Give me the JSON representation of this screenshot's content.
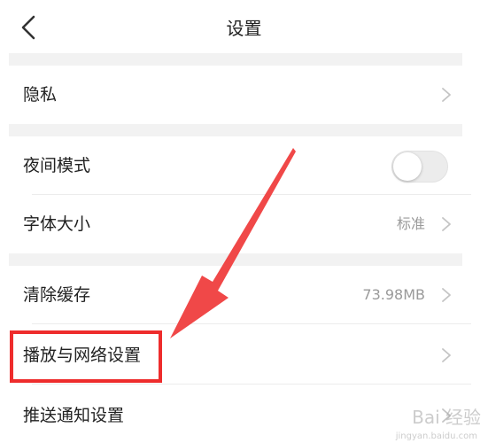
{
  "header": {
    "title": "设置",
    "back_icon": "chevron-left-icon"
  },
  "settings": {
    "privacy": {
      "label": "隐私"
    },
    "night_mode": {
      "label": "夜间模式",
      "enabled": false
    },
    "font_size": {
      "label": "字体大小",
      "value": "标准"
    },
    "clear_cache": {
      "label": "清除缓存",
      "value": "73.98MB"
    },
    "playback_network": {
      "label": "播放与网络设置"
    },
    "push_notification": {
      "label": "推送通知设置"
    }
  },
  "annotation": {
    "highlight_color": "#ee2c2c",
    "arrow_color": "#f04848"
  },
  "watermark": {
    "text": "Bai 经验",
    "sub": "jingyan.baidu.com"
  }
}
